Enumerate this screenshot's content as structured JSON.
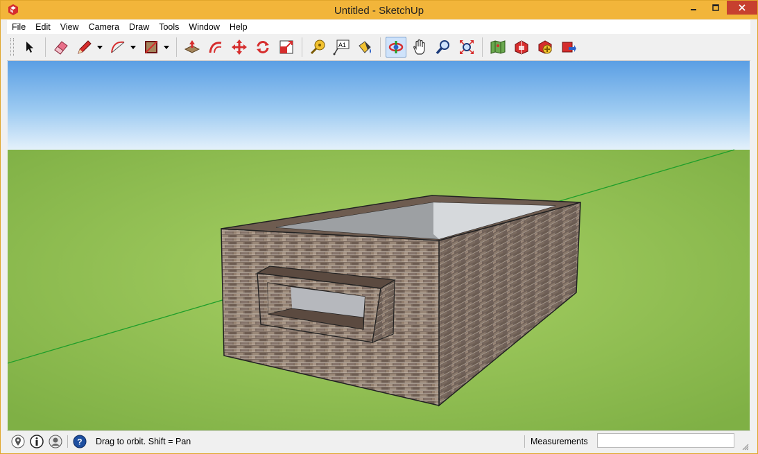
{
  "window": {
    "title": "Untitled - SketchUp"
  },
  "menubar": {
    "items": [
      "File",
      "Edit",
      "View",
      "Camera",
      "Draw",
      "Tools",
      "Window",
      "Help"
    ]
  },
  "toolbar": {
    "tools": [
      {
        "name": "select-tool",
        "icon": "cursor-arrow-icon"
      },
      {
        "name": "eraser-tool",
        "icon": "eraser-icon"
      },
      {
        "name": "line-tool",
        "icon": "pencil-icon"
      },
      {
        "name": "arc-tool",
        "icon": "arc-icon"
      },
      {
        "name": "rectangle-tool",
        "icon": "rectangle-icon"
      },
      {
        "name": "push-pull-tool",
        "icon": "push-pull-icon"
      },
      {
        "name": "offset-tool",
        "icon": "offset-icon"
      },
      {
        "name": "move-tool",
        "icon": "move-icon"
      },
      {
        "name": "rotate-tool",
        "icon": "rotate-icon"
      },
      {
        "name": "scale-tool",
        "icon": "scale-icon"
      },
      {
        "name": "tape-measure-tool",
        "icon": "tape-measure-icon"
      },
      {
        "name": "text-tool",
        "icon": "text-icon",
        "label": "A1"
      },
      {
        "name": "paint-bucket-tool",
        "icon": "paint-bucket-icon"
      },
      {
        "name": "orbit-tool",
        "icon": "orbit-icon",
        "active": true
      },
      {
        "name": "pan-tool",
        "icon": "hand-icon"
      },
      {
        "name": "zoom-tool",
        "icon": "magnifier-icon"
      },
      {
        "name": "zoom-extents-tool",
        "icon": "zoom-extents-icon"
      },
      {
        "name": "map-tool",
        "icon": "map-icon"
      },
      {
        "name": "warehouse-tool",
        "icon": "warehouse-icon"
      },
      {
        "name": "extension-warehouse-tool",
        "icon": "extension-warehouse-icon"
      },
      {
        "name": "share-model-tool",
        "icon": "share-model-icon"
      }
    ],
    "colors": {
      "accent_red": "#d62d2d",
      "accent_active": "#cfe3fb"
    }
  },
  "viewport": {
    "sky_top": "#62a6e8",
    "sky_bottom": "#d9ecfa",
    "ground": "#8fc14f",
    "axis_green": "#1f9e2a",
    "brick": "#7a6a5e"
  },
  "statusbar": {
    "icons": [
      "geo-location-icon",
      "credits-icon",
      "user-icon",
      "help-icon"
    ],
    "message": "Drag to orbit.  Shift = Pan",
    "measurements_label": "Measurements",
    "measurements_value": ""
  }
}
